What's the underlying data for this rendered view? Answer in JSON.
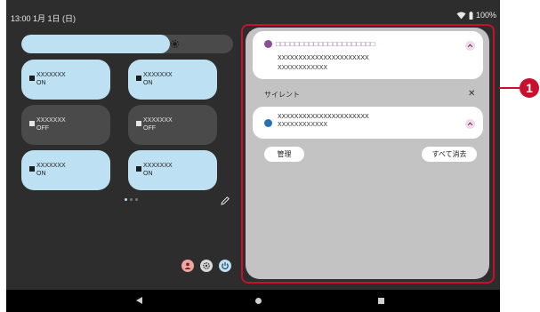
{
  "status_bar": {
    "time_date": "13:00  1月 1日 (日)",
    "battery": "100%",
    "wifi_icon": "wifi-icon",
    "battery_icon": "battery-icon"
  },
  "brightness": {
    "level": 0.7,
    "icon": "brightness-icon"
  },
  "tiles": [
    {
      "name": "XXXXXXX",
      "state": "ON"
    },
    {
      "name": "XXXXXXX",
      "state": "ON"
    },
    {
      "name": "XXXXXXX",
      "state": "OFF"
    },
    {
      "name": "XXXXXXX",
      "state": "OFF"
    },
    {
      "name": "XXXXXXX",
      "state": "ON"
    },
    {
      "name": "XXXXXXX",
      "state": "ON"
    }
  ],
  "pager": {
    "pages": 3,
    "current": 1
  },
  "notifications": [
    {
      "app": "□□□□□□□□□□□□□□□□□□□□□",
      "title": "XXXXXXXXXXXXXXXXXXXXXX",
      "text": "XXXXXXXXXXXX"
    },
    {
      "title": "XXXXXXXXXXXXXXXXXXXXXX",
      "text": "XXXXXXXXXXXX"
    }
  ],
  "silent_section": {
    "label": "サイレント",
    "close": "✕"
  },
  "buttons": {
    "manage": "管理",
    "clear_all": "すべて消去"
  },
  "callout": {
    "number": "1"
  },
  "colors": {
    "accent": "#bde0f3",
    "tile_off": "#4a4a4a",
    "background": "#2d2d2d",
    "shade": "#c3c3c3",
    "callout": "#c8102e",
    "app_dot_1": "#8e4a9c",
    "app_dot_2": "#2a6fb0"
  }
}
